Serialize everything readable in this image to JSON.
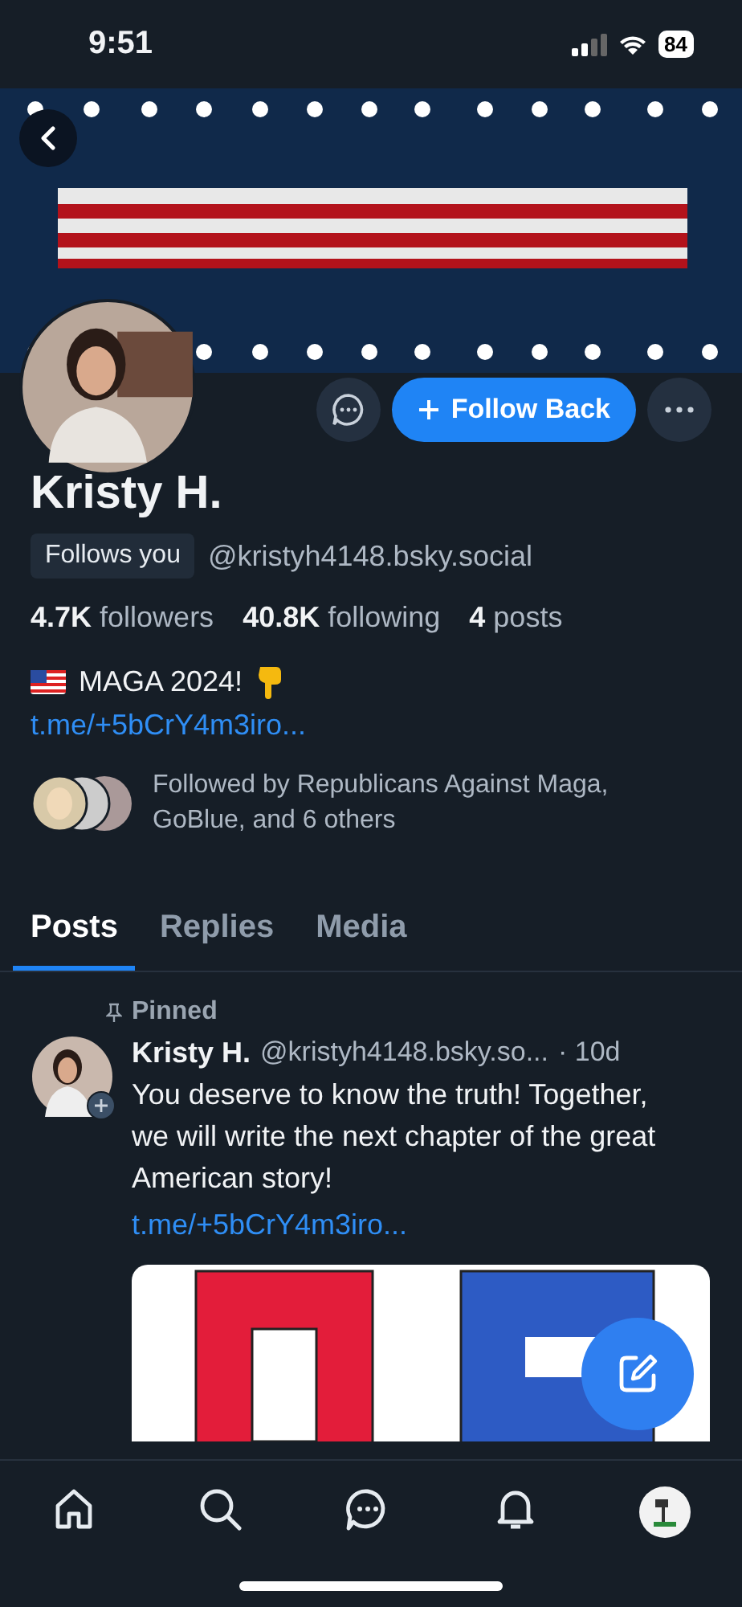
{
  "status_bar": {
    "time": "9:51",
    "battery": "84"
  },
  "profile": {
    "name": "Kristy H.",
    "follows_you": "Follows you",
    "handle": "@kristyh4148.bsky.social",
    "stats": [
      "**4.7K** followers",
      "**40.8K** following",
      "**4** posts"
    ],
    "bio": "MAGA 2024!",
    "bio_link": "t.me/+5bCrY4m3iro...",
    "followed_by": "Followed by Republicans Against Maga, GoBlue, and 6 others",
    "follow_button": "Follow Back"
  },
  "tabs": [
    {
      "label": "Posts",
      "selected": true
    },
    {
      "label": "Replies",
      "selected": false
    },
    {
      "label": "Media",
      "selected": false
    }
  ],
  "pinned_post": {
    "pinned_label": "Pinned",
    "author": "Kristy H.",
    "handle": "@kristyh4148.bsky.so...",
    "time": "· 10d",
    "text": "You deserve to know the truth! Together, we will write the next chapter of the great American story!",
    "link": "t.me/+5bCrY4m3iro..."
  },
  "nav": [
    {
      "kind": "home"
    },
    {
      "kind": "search"
    },
    {
      "kind": "chat"
    },
    {
      "kind": "bell"
    },
    {
      "kind": "avatar"
    }
  ]
}
